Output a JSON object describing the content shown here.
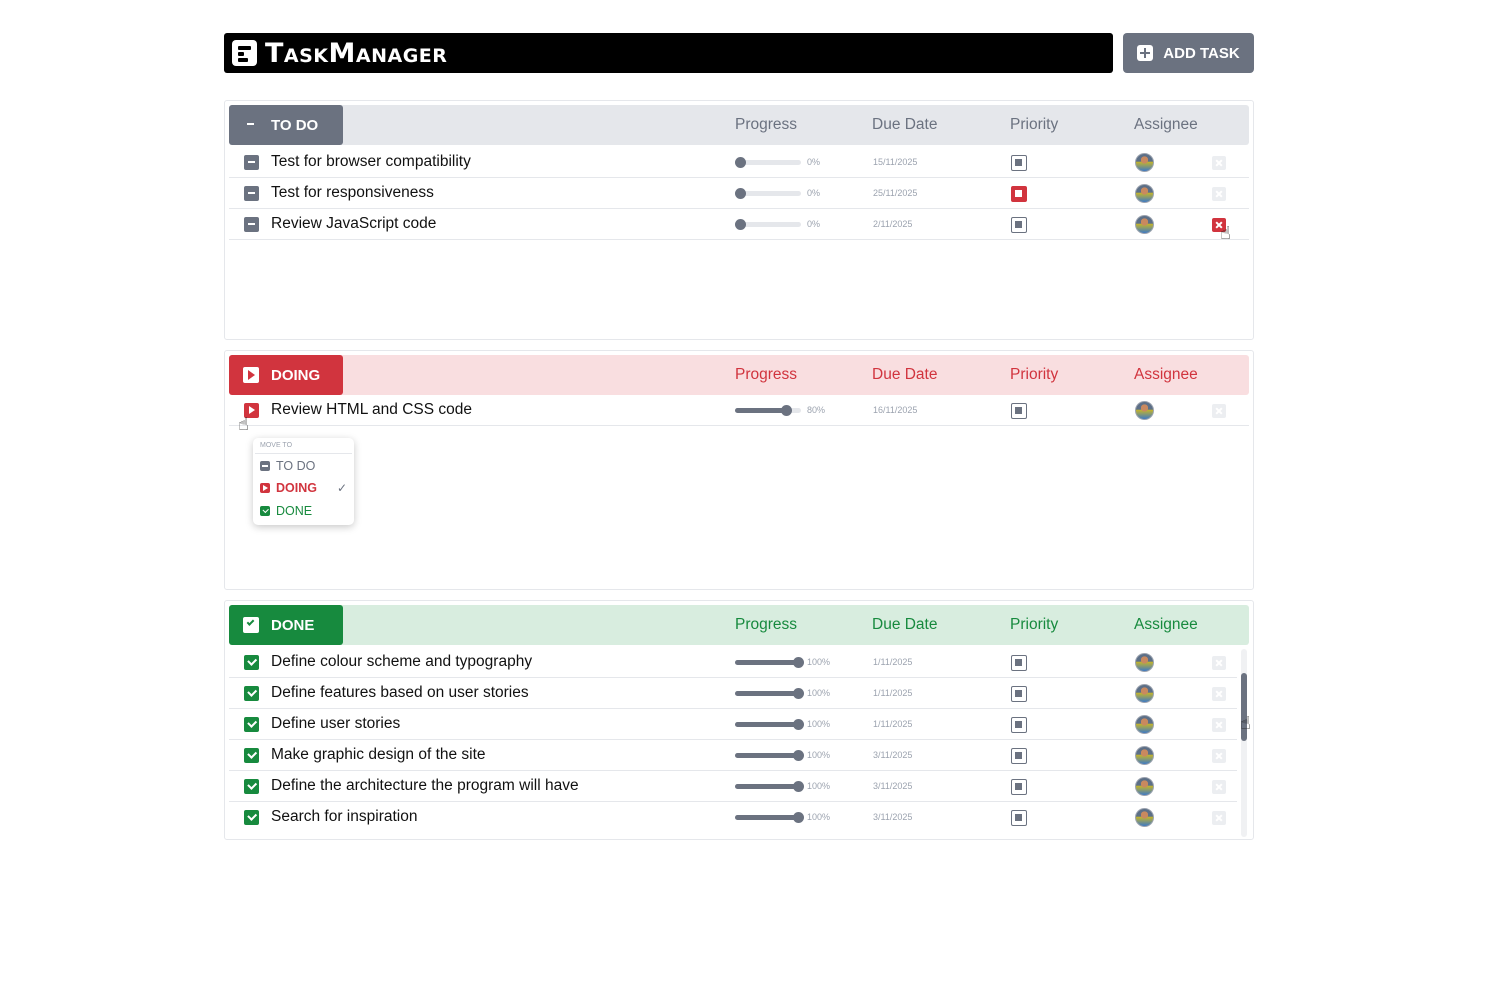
{
  "app": {
    "title": "TaskManager",
    "add_task_label": "ADD TASK"
  },
  "columns": {
    "progress": "Progress",
    "due_date": "Due Date",
    "priority": "Priority",
    "assignee": "Assignee"
  },
  "colors": {
    "todo": "#6b7280",
    "doing": "#d1343e",
    "done": "#178a3e"
  },
  "sections": {
    "todo": {
      "label": "TO DO",
      "tasks": [
        {
          "name": "Test for browser compatibility",
          "progress": 0,
          "progress_text": "0%",
          "due": "15/11/2025",
          "priority": "normal"
        },
        {
          "name": "Test for responsiveness",
          "progress": 0,
          "progress_text": "0%",
          "due": "25/11/2025",
          "priority": "high"
        },
        {
          "name": "Review JavaScript code",
          "progress": 0,
          "progress_text": "0%",
          "due": "2/11/2025",
          "priority": "normal"
        }
      ]
    },
    "doing": {
      "label": "DOING",
      "tasks": [
        {
          "name": "Review HTML and CSS code",
          "progress": 80,
          "progress_text": "80%",
          "due": "16/11/2025",
          "priority": "normal"
        }
      ]
    },
    "done": {
      "label": "DONE",
      "tasks": [
        {
          "name": "Define colour scheme and typography",
          "progress": 100,
          "progress_text": "100%",
          "due": "1/11/2025",
          "priority": "normal"
        },
        {
          "name": "Define features based on user stories",
          "progress": 100,
          "progress_text": "100%",
          "due": "1/11/2025",
          "priority": "normal"
        },
        {
          "name": "Define user stories",
          "progress": 100,
          "progress_text": "100%",
          "due": "1/11/2025",
          "priority": "normal"
        },
        {
          "name": "Make graphic design of the site",
          "progress": 100,
          "progress_text": "100%",
          "due": "3/11/2025",
          "priority": "normal"
        },
        {
          "name": "Define the architecture the program will have",
          "progress": 100,
          "progress_text": "100%",
          "due": "3/11/2025",
          "priority": "normal"
        },
        {
          "name": "Search for inspiration",
          "progress": 100,
          "progress_text": "100%",
          "due": "3/11/2025",
          "priority": "normal"
        }
      ]
    }
  },
  "move_menu": {
    "heading": "MOVE TO",
    "items": [
      "TO DO",
      "DOING",
      "DONE"
    ],
    "selected": "DOING",
    "check": "✓"
  }
}
